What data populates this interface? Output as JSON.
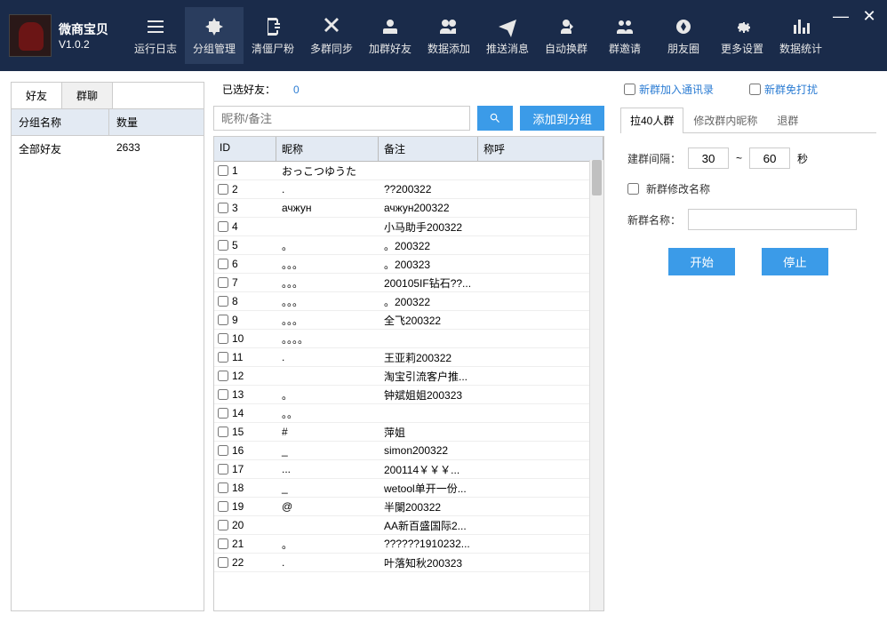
{
  "app": {
    "name": "微商宝贝",
    "version": "V1.0.2"
  },
  "toolbar": [
    {
      "label": "运行日志"
    },
    {
      "label": "分组管理"
    },
    {
      "label": "清僵尸粉"
    },
    {
      "label": "多群同步"
    },
    {
      "label": "加群好友"
    },
    {
      "label": "数据添加"
    },
    {
      "label": "推送消息"
    },
    {
      "label": "自动换群"
    },
    {
      "label": "群邀请"
    },
    {
      "label": "朋友圈"
    },
    {
      "label": "更多设置"
    },
    {
      "label": "数据统计"
    }
  ],
  "leftTabs": {
    "friends": "好友",
    "groups": "群聊"
  },
  "leftGrid": {
    "headGroupName": "分组名称",
    "headCount": "数量",
    "row1Name": "全部好友",
    "row1Count": "2633"
  },
  "mid": {
    "selectedLabel": "已选好友：",
    "selectedCount": "0",
    "searchPlaceholder": "昵称/备注",
    "addToGroup": "添加到分组",
    "colId": "ID",
    "colNick": "昵称",
    "colRemark": "备注",
    "colCall": "称呼",
    "rows": [
      {
        "id": "1",
        "nick": "おっこつゆうた",
        "remark": "",
        "call": ""
      },
      {
        "id": "2",
        "nick": ".",
        "remark": "??200322",
        "call": ""
      },
      {
        "id": "3",
        "nick": "ачжун",
        "remark": "ачжун200322",
        "call": ""
      },
      {
        "id": "4",
        "nick": "",
        "remark": "小马助手200322",
        "call": ""
      },
      {
        "id": "5",
        "nick": "。",
        "remark": "。200322",
        "call": ""
      },
      {
        "id": "6",
        "nick": "。。。",
        "remark": "。200323",
        "call": ""
      },
      {
        "id": "7",
        "nick": "。。。",
        "remark": "200105IF钻石??...",
        "call": ""
      },
      {
        "id": "8",
        "nick": "。。。",
        "remark": "。200322",
        "call": ""
      },
      {
        "id": "9",
        "nick": "。。。",
        "remark": "全飞200322",
        "call": ""
      },
      {
        "id": "10",
        "nick": "。。。。",
        "remark": "",
        "call": ""
      },
      {
        "id": "11",
        "nick": ".",
        "remark": "王亚莉200322",
        "call": ""
      },
      {
        "id": "12",
        "nick": "",
        "remark": "淘宝引流客户推...",
        "call": ""
      },
      {
        "id": "13",
        "nick": "。",
        "remark": "钟斌姐姐200323",
        "call": ""
      },
      {
        "id": "14",
        "nick": "。。",
        "remark": "",
        "call": ""
      },
      {
        "id": "15",
        "nick": "#",
        "remark": "萍姐",
        "call": ""
      },
      {
        "id": "16",
        "nick": "_",
        "remark": "simon200322",
        "call": ""
      },
      {
        "id": "17",
        "nick": "...",
        "remark": "200114￥￥￥...",
        "call": ""
      },
      {
        "id": "18",
        "nick": "_",
        "remark": "wetool单开一份...",
        "call": ""
      },
      {
        "id": "19",
        "nick": "@",
        "remark": "半闌200322",
        "call": ""
      },
      {
        "id": "20",
        "nick": "",
        "remark": "AA新百盛国际2...",
        "call": ""
      },
      {
        "id": "21",
        "nick": "。",
        "remark": "??????1910232...",
        "call": ""
      },
      {
        "id": "22",
        "nick": ".",
        "remark": "叶落知秋200323",
        "call": ""
      }
    ]
  },
  "right": {
    "chkAddContacts": "新群加入通讯录",
    "chkNoDisturb": "新群免打扰",
    "tab40": "拉40人群",
    "tabRename": "修改群内昵称",
    "tabExit": "退群",
    "intervalLabel": "建群间隔：",
    "intervalMin": "30",
    "intervalSep": "~",
    "intervalMax": "60",
    "intervalUnit": "秒",
    "chkModifyName": "新群修改名称",
    "newNameLabel": "新群名称：",
    "btnStart": "开始",
    "btnStop": "停止"
  }
}
